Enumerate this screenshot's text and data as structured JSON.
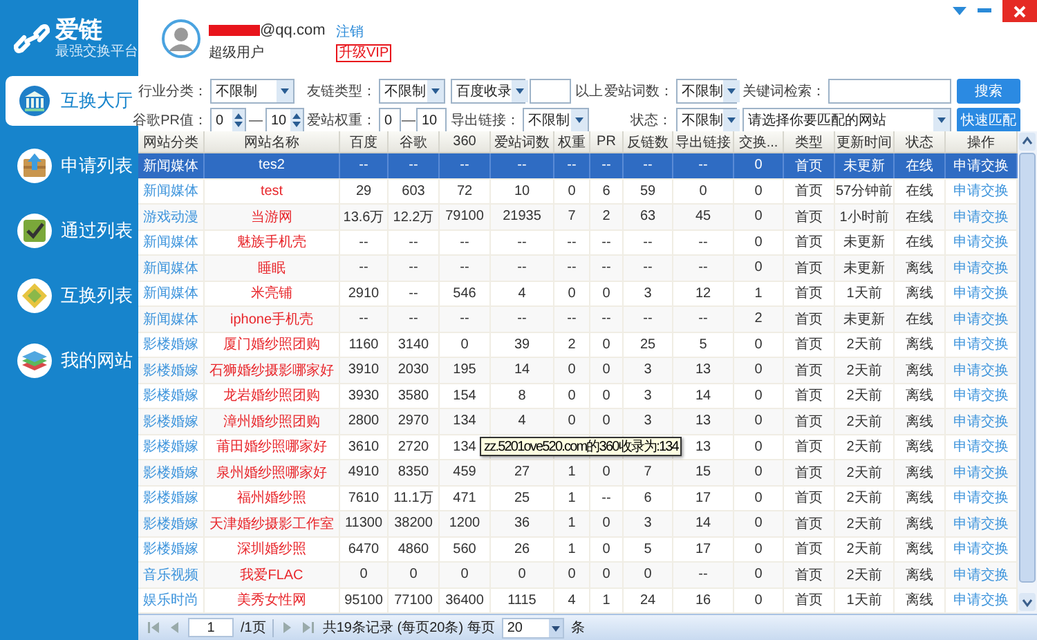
{
  "app": {
    "logo": "爱链",
    "tagline": "最强交换平台"
  },
  "sidebar": {
    "items": [
      {
        "label": "互换大厅",
        "selected": true
      },
      {
        "label": "申请列表",
        "selected": false
      },
      {
        "label": "通过列表",
        "selected": false
      },
      {
        "label": "互换列表",
        "selected": false
      },
      {
        "label": "我的网站",
        "selected": false
      }
    ]
  },
  "user": {
    "email": "@qq.com",
    "role": "超级用户",
    "logout": "注销",
    "upgrade": "升级VIP"
  },
  "filters": {
    "rows": [
      {
        "fields": [
          {
            "label": "行业分类：",
            "controls": [
              {
                "kind": "select",
                "value": "不限制"
              }
            ]
          },
          {
            "label": "友链类型：",
            "controls": [
              {
                "kind": "select",
                "value": "不限制"
              },
              {
                "kind": "select",
                "value": "百度收录"
              },
              {
                "kind": "input"
              },
              {
                "kind": "text",
                "text": "以上"
              }
            ]
          },
          {
            "label": "爱站词数：",
            "controls": [
              {
                "kind": "select",
                "value": "不限制"
              }
            ]
          },
          {
            "label": "关键词检索：",
            "controls": [
              {
                "kind": "input"
              },
              {
                "kind": "button",
                "text": "搜索"
              }
            ]
          }
        ]
      },
      {
        "fields": [
          {
            "label": "谷歌PR值：",
            "controls": [
              {
                "kind": "spin",
                "value": "0"
              },
              {
                "kind": "text",
                "text": "—"
              },
              {
                "kind": "spin",
                "value": "10"
              }
            ]
          },
          {
            "label": "爱站权重：",
            "controls": [
              {
                "kind": "input",
                "value": "0"
              },
              {
                "kind": "text",
                "text": "—"
              },
              {
                "kind": "input",
                "value": "10"
              }
            ]
          },
          {
            "label": "导出链接：",
            "controls": [
              {
                "kind": "select",
                "value": "不限制"
              }
            ]
          },
          {
            "label": "状态：",
            "controls": [
              {
                "kind": "select",
                "value": "不限制"
              },
              {
                "kind": "select",
                "value": "请选择你要匹配的网站"
              },
              {
                "kind": "button",
                "text": "快速匹配"
              }
            ]
          }
        ]
      }
    ]
  },
  "table": {
    "columns": [
      {
        "label": "网站分类",
        "kind": "category"
      },
      {
        "label": "网站名称",
        "kind": "name"
      },
      {
        "label": "百度",
        "kind": "number"
      },
      {
        "label": "谷歌",
        "kind": "number"
      },
      {
        "label": "360",
        "kind": "number"
      },
      {
        "label": "爱站词数",
        "kind": "number"
      },
      {
        "label": "权重",
        "kind": "number"
      },
      {
        "label": "PR",
        "kind": "number"
      },
      {
        "label": "反链数",
        "kind": "number"
      },
      {
        "label": "导出链接",
        "kind": "number"
      },
      {
        "label": "交换...",
        "kind": "number"
      },
      {
        "label": "类型",
        "kind": "number"
      },
      {
        "label": "更新时间",
        "kind": "number"
      },
      {
        "label": "状态",
        "kind": "number"
      },
      {
        "label": "操作",
        "kind": "action"
      }
    ],
    "rows": [
      {
        "selected": true,
        "cells": [
          "新闻媒体",
          "tes2",
          "--",
          "--",
          "--",
          "--",
          "--",
          "--",
          "--",
          "--",
          "0",
          "首页",
          "未更新",
          "在线",
          "申请交换"
        ]
      },
      {
        "selected": false,
        "cells": [
          "新闻媒体",
          "test",
          "29",
          "603",
          "72",
          "10",
          "0",
          "6",
          "59",
          "0",
          "0",
          "首页",
          "57分钟前",
          "在线",
          "申请交换"
        ]
      },
      {
        "selected": false,
        "cells": [
          "游戏动漫",
          "当游网",
          "13.6万",
          "12.2万",
          "79100",
          "21935",
          "7",
          "2",
          "63",
          "45",
          "0",
          "首页",
          "1小时前",
          "在线",
          "申请交换"
        ]
      },
      {
        "selected": false,
        "cells": [
          "新闻媒体",
          "魅族手机壳",
          "--",
          "--",
          "--",
          "--",
          "--",
          "--",
          "--",
          "--",
          "0",
          "首页",
          "未更新",
          "在线",
          "申请交换"
        ]
      },
      {
        "selected": false,
        "cells": [
          "新闻媒体",
          "睡眠",
          "--",
          "--",
          "--",
          "--",
          "--",
          "--",
          "--",
          "--",
          "0",
          "首页",
          "未更新",
          "离线",
          "申请交换"
        ]
      },
      {
        "selected": false,
        "cells": [
          "新闻媒体",
          "米亮铺",
          "2910",
          "--",
          "546",
          "4",
          "0",
          "0",
          "3",
          "12",
          "1",
          "首页",
          "1天前",
          "离线",
          "申请交换"
        ]
      },
      {
        "selected": false,
        "cells": [
          "新闻媒体",
          "iphone手机壳",
          "--",
          "--",
          "--",
          "--",
          "--",
          "--",
          "--",
          "--",
          "2",
          "首页",
          "未更新",
          "在线",
          "申请交换"
        ]
      },
      {
        "selected": false,
        "cells": [
          "影楼婚嫁",
          "厦门婚纱照团购",
          "1160",
          "3140",
          "0",
          "39",
          "2",
          "0",
          "25",
          "5",
          "0",
          "首页",
          "2天前",
          "离线",
          "申请交换"
        ]
      },
      {
        "selected": false,
        "cells": [
          "影楼婚嫁",
          "石狮婚纱摄影哪家好",
          "3910",
          "2030",
          "195",
          "14",
          "0",
          "0",
          "3",
          "13",
          "0",
          "首页",
          "2天前",
          "离线",
          "申请交换"
        ]
      },
      {
        "selected": false,
        "cells": [
          "影楼婚嫁",
          "龙岩婚纱照团购",
          "3930",
          "3580",
          "154",
          "8",
          "0",
          "0",
          "3",
          "14",
          "0",
          "首页",
          "2天前",
          "离线",
          "申请交换"
        ]
      },
      {
        "selected": false,
        "cells": [
          "影楼婚嫁",
          "漳州婚纱照团购",
          "2800",
          "2970",
          "134",
          "4",
          "0",
          "0",
          "3",
          "13",
          "0",
          "首页",
          "2天前",
          "离线",
          "申请交换"
        ]
      },
      {
        "selected": false,
        "cells": [
          "影楼婚嫁",
          "莆田婚纱照哪家好",
          "3610",
          "2720",
          "134",
          null,
          null,
          null,
          null,
          "13",
          "0",
          "首页",
          "2天前",
          "离线",
          "申请交换"
        ],
        "tooltip": "zz.5201ove520.com的360收录为:134"
      },
      {
        "selected": false,
        "cells": [
          "影楼婚嫁",
          "泉州婚纱照哪家好",
          "4910",
          "8350",
          "459",
          "27",
          "1",
          "0",
          "7",
          "15",
          "0",
          "首页",
          "2天前",
          "离线",
          "申请交换"
        ]
      },
      {
        "selected": false,
        "cells": [
          "影楼婚嫁",
          "福州婚纱照",
          "7610",
          "11.1万",
          "471",
          "25",
          "1",
          "--",
          "6",
          "17",
          "0",
          "首页",
          "2天前",
          "离线",
          "申请交换"
        ]
      },
      {
        "selected": false,
        "cells": [
          "影楼婚嫁",
          "天津婚纱摄影工作室",
          "11300",
          "38200",
          "1200",
          "36",
          "1",
          "0",
          "3",
          "14",
          "0",
          "首页",
          "2天前",
          "离线",
          "申请交换"
        ]
      },
      {
        "selected": false,
        "cells": [
          "影楼婚嫁",
          "深圳婚纱照",
          "6470",
          "4860",
          "560",
          "26",
          "1",
          "0",
          "5",
          "17",
          "0",
          "首页",
          "2天前",
          "离线",
          "申请交换"
        ]
      },
      {
        "selected": false,
        "cells": [
          "音乐视频",
          "我爱FLAC",
          "0",
          "0",
          "0",
          "0",
          "0",
          "0",
          "0",
          "--",
          "0",
          "首页",
          "2天前",
          "离线",
          "申请交换"
        ]
      },
      {
        "selected": false,
        "cells": [
          "娱乐时尚",
          "美秀女性网",
          "95100",
          "77100",
          "36400",
          "1115",
          "4",
          "1",
          "24",
          "16",
          "0",
          "首页",
          "1天前",
          "离线",
          "申请交换"
        ]
      }
    ]
  },
  "pager": {
    "page": "1",
    "pages": "/1页",
    "summary": "共19条记录 (每页20条) 每页",
    "per_page": "20",
    "unit": "条"
  }
}
